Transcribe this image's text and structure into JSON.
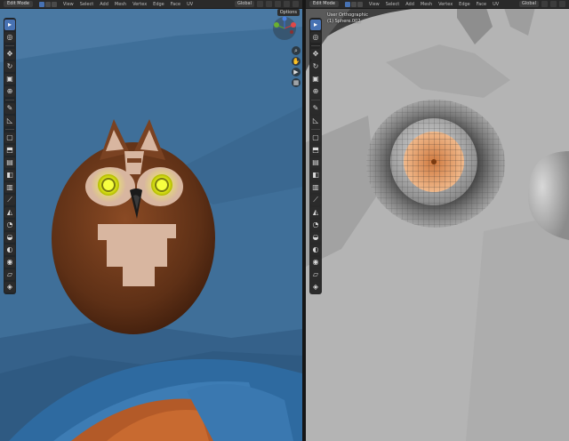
{
  "left_viewport": {
    "header": {
      "mode_label": "Edit Mode",
      "menu": [
        "View",
        "Select",
        "Add",
        "Mesh",
        "Vertex",
        "Edge",
        "Face",
        "UV"
      ],
      "transform_orientation": "Global",
      "options_label": "Options"
    },
    "toolbar_icons": [
      "cursor-select-icon",
      "3d-cursor-icon",
      "move-icon",
      "rotate-icon",
      "scale-icon",
      "transform-icon",
      "annotate-icon",
      "measure-icon",
      "add-cube-icon",
      "extrude-icon",
      "inset-icon",
      "bevel-icon",
      "loop-cut-icon",
      "knife-icon",
      "poly-build-icon",
      "spin-icon",
      "smooth-icon",
      "edge-slide-icon",
      "shrink-fatten-icon",
      "shear-icon",
      "rip-icon"
    ],
    "nav_icons": [
      "zoom-icon",
      "pan-icon",
      "camera-icon",
      "grid-icon"
    ]
  },
  "right_viewport": {
    "header": {
      "mode_label": "Edit Mode",
      "menu": [
        "View",
        "Select",
        "Add",
        "Mesh",
        "Vertex",
        "Edge",
        "Face",
        "UV"
      ],
      "transform_orientation": "Global"
    },
    "overlay_text": {
      "view_name": "User Orthographic",
      "object_name": "(1) Sphere.002"
    },
    "toolbar_icons": [
      "cursor-select-icon",
      "3d-cursor-icon",
      "move-icon",
      "rotate-icon",
      "scale-icon",
      "transform-icon",
      "annotate-icon",
      "measure-icon",
      "add-cube-icon",
      "extrude-icon",
      "inset-icon",
      "bevel-icon",
      "loop-cut-icon",
      "knife-icon",
      "poly-build-icon",
      "spin-icon",
      "smooth-icon",
      "edge-slide-icon",
      "shrink-fatten-icon",
      "shear-icon",
      "rip-icon"
    ]
  },
  "colors": {
    "selection_accent": "#4772b3",
    "sky_blue": "#3f6f99",
    "owl_brown": "#6e3a1a",
    "eye_yellow": "#e8f020",
    "mesh_grey": "#b4b4b4",
    "iris_orange": "#e0a070"
  }
}
